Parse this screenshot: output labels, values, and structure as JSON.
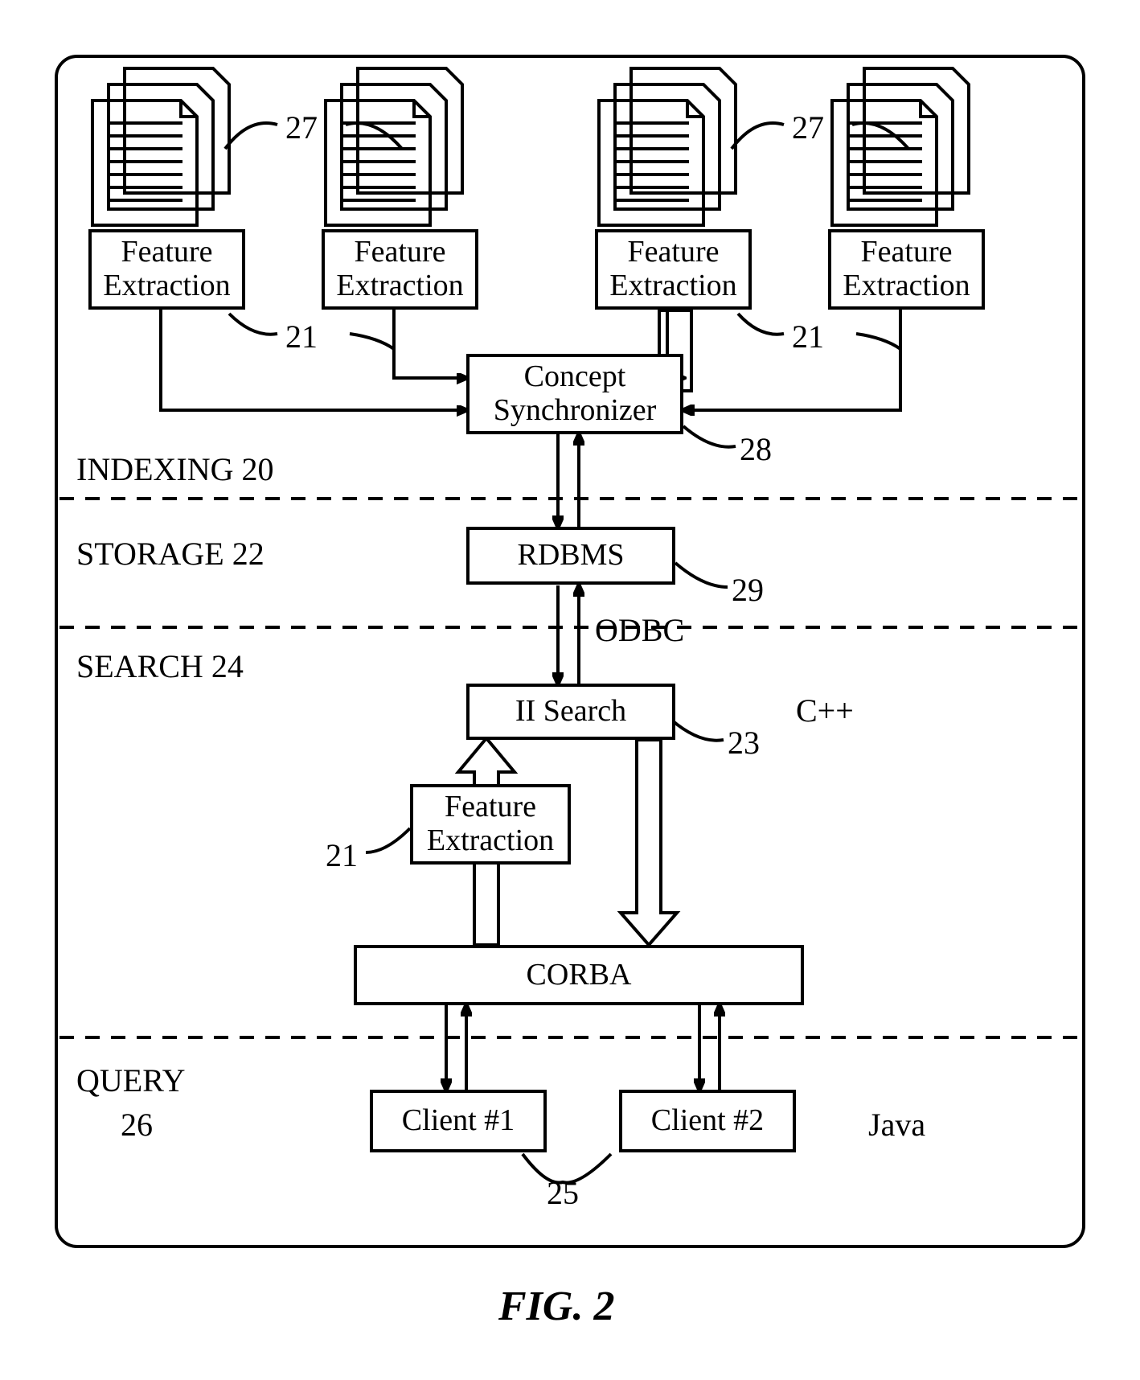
{
  "sections": {
    "indexing": {
      "label": "INDEXING 20"
    },
    "storage": {
      "label": "STORAGE 22"
    },
    "search": {
      "label": "SEARCH 24"
    },
    "query": {
      "label": "QUERY"
    },
    "query_num": "26"
  },
  "blocks": {
    "fe": "Feature\nExtraction",
    "concept_sync": "Concept\nSynchronizer",
    "rdbms": "RDBMS",
    "iisearch": "II Search",
    "corba": "CORBA",
    "client1": "Client #1",
    "client2": "Client #2"
  },
  "labels": {
    "odbc": "ODBC",
    "cpp": "C++",
    "java": "Java"
  },
  "nums": {
    "n27a": "27",
    "n27b": "27",
    "n21a": "21",
    "n21b": "21",
    "n28": "28",
    "n29": "29",
    "n23": "23",
    "n21c": "21",
    "n25": "25"
  },
  "caption": "FIG. 2"
}
